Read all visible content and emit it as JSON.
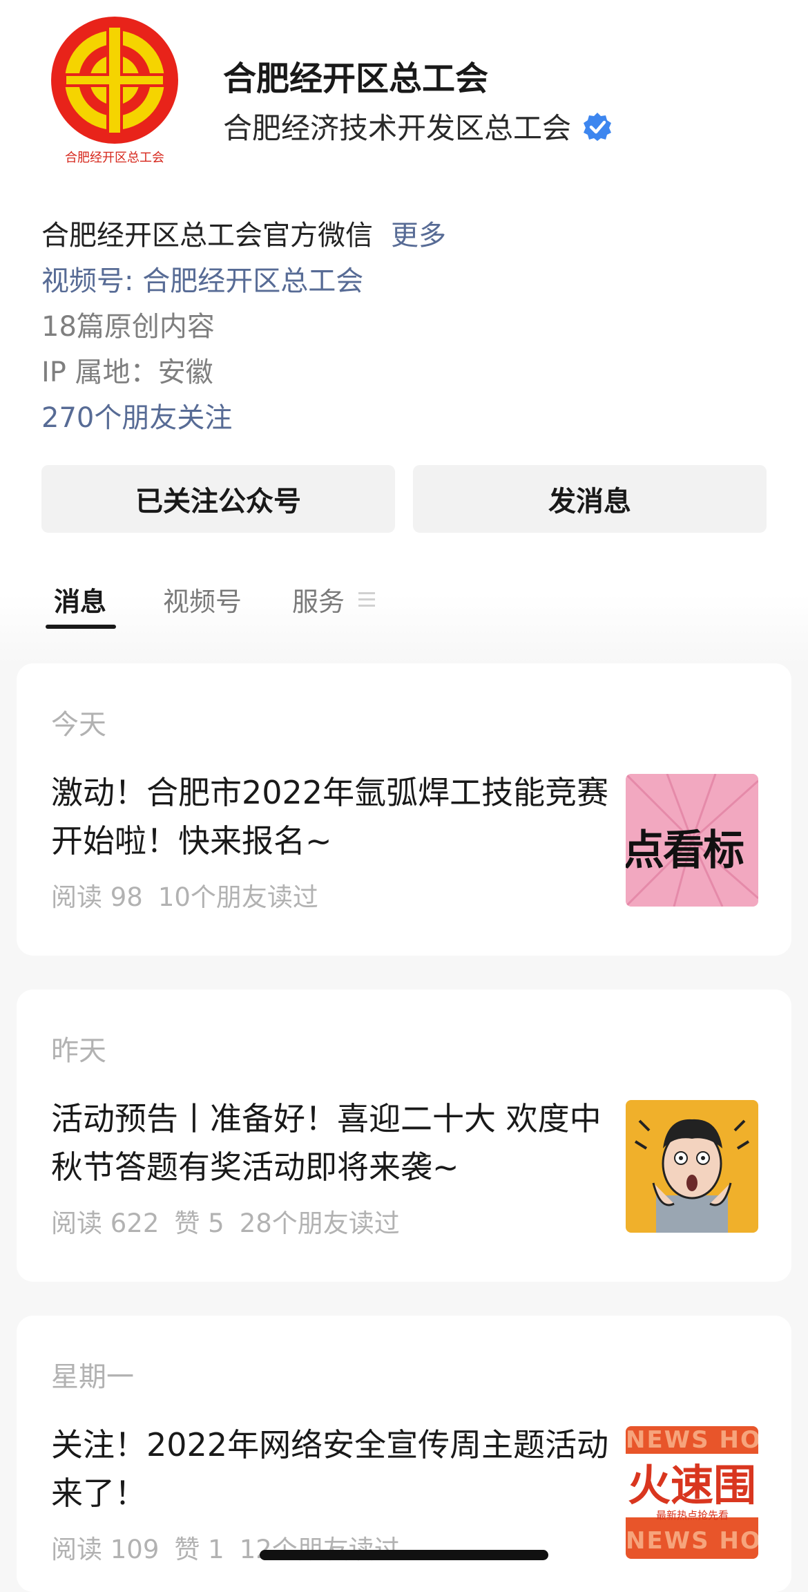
{
  "header": {
    "logo_text": "合肥经开区总工会",
    "account_name": "合肥经开区总工会",
    "account_fullname": "合肥经济技术开发区总工会",
    "verified_icon": "verified-check-icon",
    "description": "合肥经开区总工会官方微信",
    "more_label": "更多",
    "channel": "视频号: 合肥经开区总工会",
    "original_count": "18篇原创内容",
    "ip_location": "IP 属地：安徽",
    "friends_follow": "270个朋友关注"
  },
  "buttons": {
    "followed_label": "已关注公众号",
    "message_label": "发消息"
  },
  "tabs": [
    {
      "label": "消息",
      "active": true
    },
    {
      "label": "视频号",
      "active": false
    },
    {
      "label": "服务",
      "active": false,
      "icon": "menu-lines-icon"
    }
  ],
  "articles": [
    {
      "day": "今天",
      "title": "激动！合肥市2022年氩弧焊工技能竞赛开始啦！快来报名~",
      "reads": "阅读 98",
      "likes": "",
      "friends": "10个朋友读过",
      "thumb_text": "点看标"
    },
    {
      "day": "昨天",
      "title": "活动预告丨准备好！喜迎二十大 欢度中秋节答题有奖活动即将来袭~",
      "reads": "阅读 622",
      "likes": "赞 5",
      "friends": "28个朋友读过",
      "thumb_text": ""
    },
    {
      "day": "星期一",
      "title": "关注！2022年网络安全宣传周主题活动来了！",
      "reads": "阅读 109",
      "likes": "赞 1",
      "friends": "12个朋友读过",
      "thumb_text": "火速围",
      "thumb_band": "NEWS HOT",
      "thumb_sub": "最新热点抢先看"
    }
  ],
  "colors": {
    "link": "#576b95",
    "logo_red": "#e8231a",
    "logo_yellow": "#f5d400",
    "verified": "#3d86ef"
  }
}
